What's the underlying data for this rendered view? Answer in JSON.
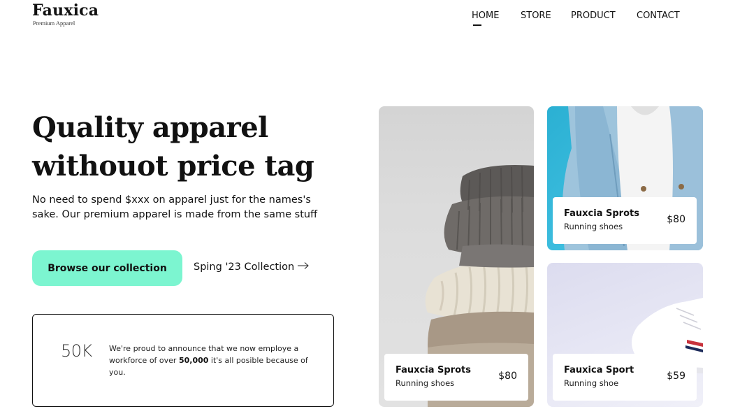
{
  "brand": {
    "name": "Fauxica",
    "tagline": "Premium Apparel"
  },
  "nav": {
    "items": [
      {
        "label": "HOME",
        "active": true
      },
      {
        "label": "STORE",
        "active": false
      },
      {
        "label": "PRODUCT",
        "active": false
      },
      {
        "label": "CONTACT",
        "active": false
      }
    ]
  },
  "hero": {
    "title_line1": "Quality apparel",
    "title_line2": "withouot price tag",
    "subtitle": "No need to spend $xxx on apparel just for the names's sake. Our premium apparel is made from the same stuff",
    "cta_label": "Browse our collection",
    "collection_link": "Sping '23 Collection"
  },
  "stats": {
    "number": "50K",
    "text_before": "We're proud to announce that we now employe a workforce of over ",
    "text_bold": "50,000",
    "text_after": " it's all posible because of you."
  },
  "products": [
    {
      "name": "Fauxcia Sprots",
      "type": "Running shoes",
      "price": "$80",
      "image": "folded-sweaters"
    },
    {
      "name": "Fauxcia Sprots",
      "type": "Running shoes",
      "price": "$80",
      "image": "denim-jacket"
    },
    {
      "name": "Fauxica Sport",
      "type": "Running shoe",
      "price": "$59",
      "image": "white-sneaker"
    }
  ],
  "colors": {
    "accent": "#7cf5d0",
    "text": "#111111",
    "jacket_bg": "#2bb0d3",
    "sweater_bg": "#d8d8d8",
    "sneaker_bg": "#e6e6f3"
  },
  "icons": {
    "collection_arrow": "arrow-right-icon"
  }
}
